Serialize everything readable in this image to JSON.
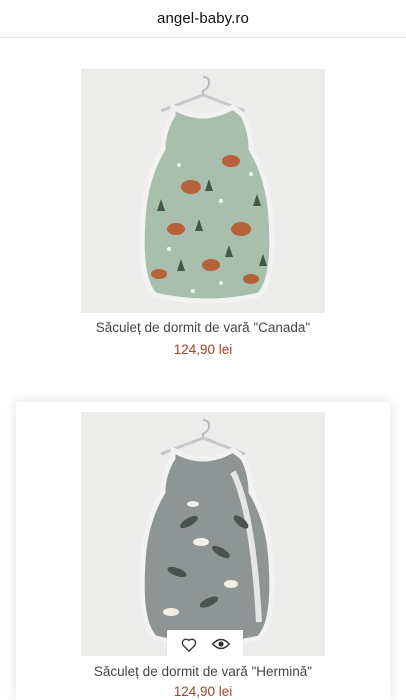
{
  "header": {
    "site_title": "angel-baby.ro"
  },
  "products": [
    {
      "name": "Săculeț de dormit de vară \"Canada\"",
      "price": "124,90 lei"
    },
    {
      "name": "Săculeț de dormit de vară \"Hermină\"",
      "price": "124,90 lei"
    }
  ],
  "actions": {
    "wishlist_icon": "heart-icon",
    "quickview_icon": "eye-icon"
  },
  "colors": {
    "price": "#a0432a",
    "canada_fabric": "#a9bfae",
    "hermina_fabric": "#8f9594"
  }
}
